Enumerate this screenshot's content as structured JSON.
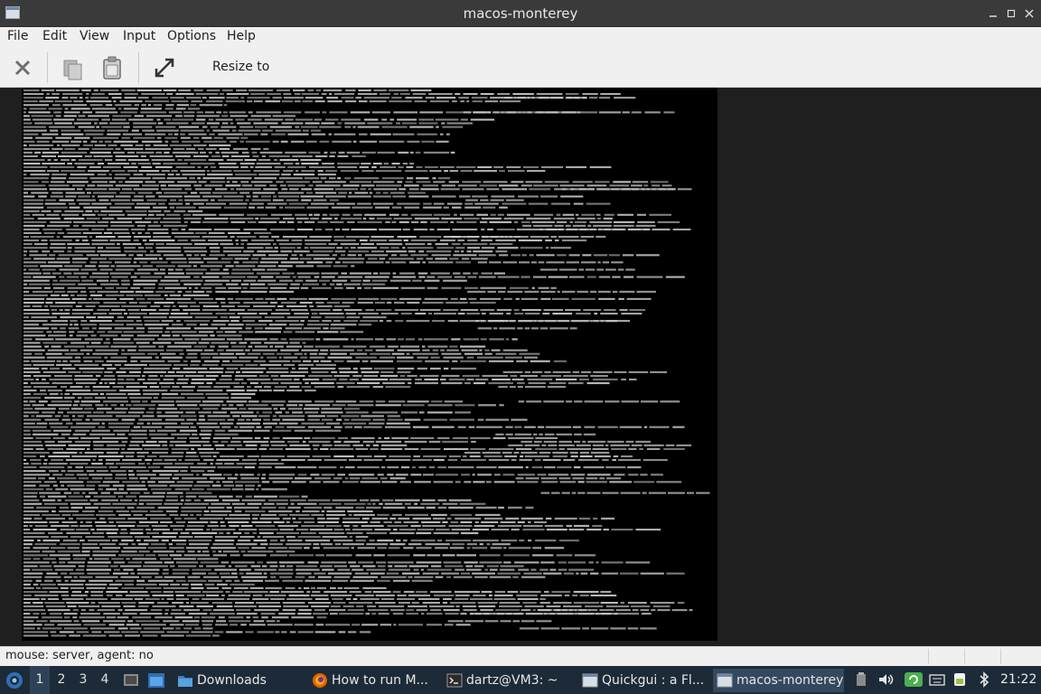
{
  "window": {
    "title": "macos-monterey",
    "controls": [
      "minimize-icon",
      "maximize-icon",
      "close-icon"
    ]
  },
  "menu": {
    "items": [
      "File",
      "Edit",
      "View",
      "Input",
      "Options",
      "Help"
    ]
  },
  "toolbar": {
    "buttons": [
      "close-icon",
      "copy-icon",
      "paste-icon",
      "fullscreen-icon"
    ],
    "resize_label": "Resize to"
  },
  "status": {
    "text": "mouse: server, agent:  no"
  },
  "taskbar": {
    "workspaces": [
      "1",
      "2",
      "3",
      "4"
    ],
    "active_workspace": "1",
    "tasks": [
      {
        "label": "Downloads",
        "icon": "folder-icon"
      },
      {
        "label": "How to run M...",
        "icon": "firefox-icon"
      },
      {
        "label": "dartz@VM3: ~",
        "icon": "terminal-icon"
      },
      {
        "label": "Quickgui : a Fl...",
        "icon": "window-icon"
      },
      {
        "label": "macos-monterey",
        "icon": "window-icon",
        "active": true
      }
    ],
    "tray": [
      "clipboard-icon",
      "volume-icon",
      "update-icon",
      "keyboard-icon",
      "battery-icon",
      "bluetooth-icon"
    ],
    "clock": "21:22"
  },
  "colors": {
    "titlebar": "#3a3a3a",
    "panel": "#1d2b38",
    "terminal_bg": "#000000",
    "terminal_text": "#c8c8c8"
  }
}
